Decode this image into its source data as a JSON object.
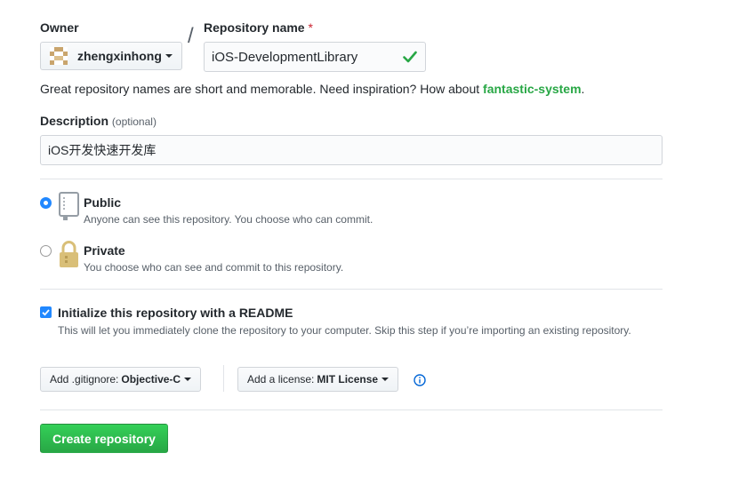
{
  "owner": {
    "label": "Owner",
    "username": "zhengxinhong"
  },
  "repository": {
    "label": "Repository name",
    "required_mark": "*",
    "value": "iOS-DevelopmentLibrary",
    "hint_prefix": "Great repository names are short and memorable. Need inspiration? How about ",
    "suggestion": "fantastic-system",
    "hint_suffix": "."
  },
  "description": {
    "label": "Description",
    "optional": "(optional)",
    "value": "iOS开发快速开发库"
  },
  "visibility": {
    "selected": "public",
    "public": {
      "title": "Public",
      "note": "Anyone can see this repository. You choose who can commit."
    },
    "private": {
      "title": "Private",
      "note": "You choose who can see and commit to this repository."
    }
  },
  "readme": {
    "checked": true,
    "title": "Initialize this repository with a README",
    "note": "This will let you immediately clone the repository to your computer. Skip this step if you’re importing an existing repository."
  },
  "gitignore": {
    "prefix": "Add .gitignore:",
    "value": "Objective-C"
  },
  "license": {
    "prefix": "Add a license:",
    "value": "MIT License"
  },
  "submit_label": "Create repository",
  "colors": {
    "accent": "#2188ff",
    "success": "#28a745",
    "required": "#cb2431"
  }
}
